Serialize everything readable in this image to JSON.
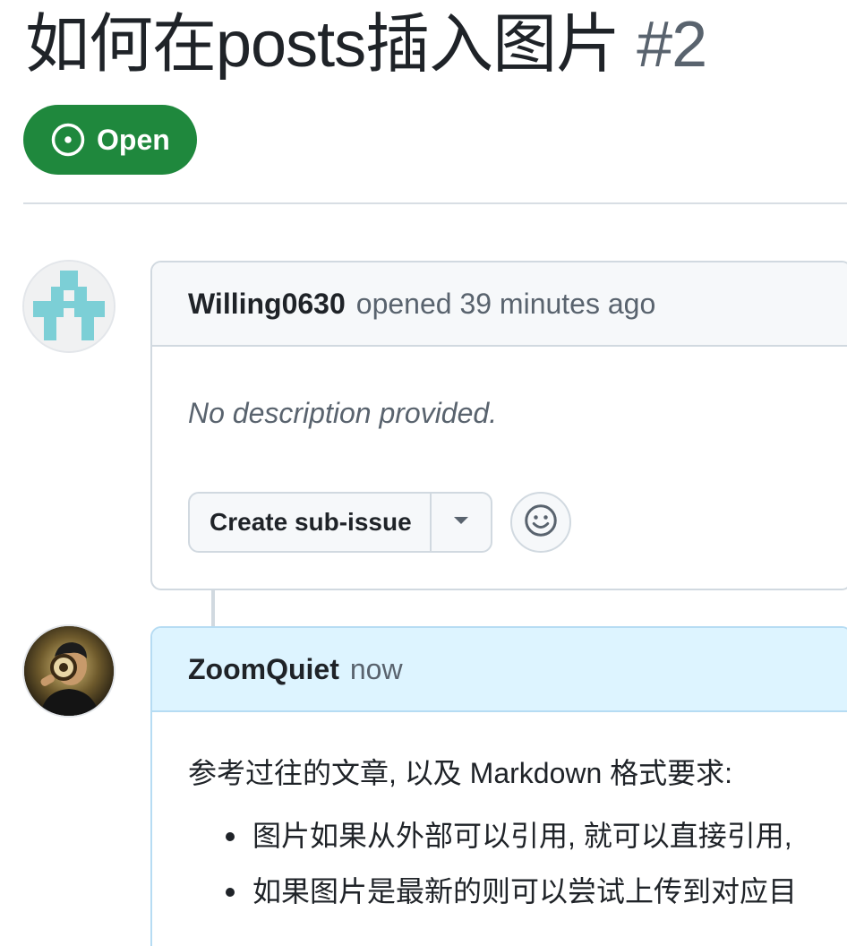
{
  "issue": {
    "title": "如何在posts插入图片",
    "number": "#2",
    "state": "Open",
    "state_icon": "issue-opened-icon",
    "state_color": "#1f883d"
  },
  "comments": [
    {
      "author": "Willing0630",
      "meta": "opened 39 minutes ago",
      "avatar": "identicon-avatar",
      "body_empty": "No description provided.",
      "actions": {
        "create_sub_issue": "Create sub-issue",
        "dropdown_icon": "triangle-down-icon",
        "reaction_icon": "smiley-icon"
      }
    },
    {
      "author": "ZoomQuiet",
      "meta": "now",
      "avatar": "photo-avatar",
      "highlight_color": "#ddf4ff",
      "body_text": "参考过往的文章, 以及 Markdown 格式要求:",
      "bullets": [
        "图片如果从外部可以引用, 就可以直接引用,",
        "如果图片是最新的则可以尝试上传到对应目"
      ]
    }
  ]
}
